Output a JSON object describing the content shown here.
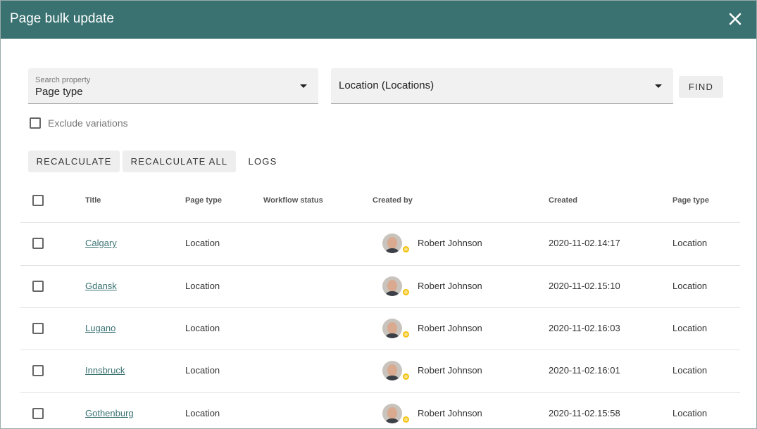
{
  "dialog": {
    "title": "Page bulk update"
  },
  "search": {
    "property_label": "Search property",
    "property_value": "Page type",
    "type_value": "Location (Locations)",
    "find_label": "FIND",
    "exclude_variations_label": "Exclude variations",
    "exclude_variations_checked": false
  },
  "actions": {
    "recalculate_label": "RECALCULATE",
    "recalculate_all_label": "RECALCULATE ALL",
    "logs_label": "LOGS"
  },
  "table": {
    "columns": [
      "Title",
      "Page type",
      "Workflow status",
      "Created by",
      "Created",
      "Page type"
    ],
    "rows": [
      {
        "title": "Calgary",
        "page_type": "Location",
        "workflow_status": "",
        "created_by": "Robert Johnson",
        "created": "2020-11-02.14:17",
        "page_type2": "Location"
      },
      {
        "title": "Gdansk",
        "page_type": "Location",
        "workflow_status": "",
        "created_by": "Robert Johnson",
        "created": "2020-11-02.15:10",
        "page_type2": "Location"
      },
      {
        "title": "Lugano",
        "page_type": "Location",
        "workflow_status": "",
        "created_by": "Robert Johnson",
        "created": "2020-11-02.16:03",
        "page_type2": "Location"
      },
      {
        "title": "Innsbruck",
        "page_type": "Location",
        "workflow_status": "",
        "created_by": "Robert Johnson",
        "created": "2020-11-02.16:01",
        "page_type2": "Location"
      },
      {
        "title": "Gothenburg",
        "page_type": "Location",
        "workflow_status": "",
        "created_by": "Robert Johnson",
        "created": "2020-11-02.15:58",
        "page_type2": "Location"
      }
    ]
  },
  "colors": {
    "header": "#3a7272",
    "link": "#3a7272",
    "status_dot": "#f4c20d"
  },
  "icons": {
    "close": "close-icon",
    "dropdown": "chevron-down-icon",
    "checkbox": "checkbox-icon"
  }
}
